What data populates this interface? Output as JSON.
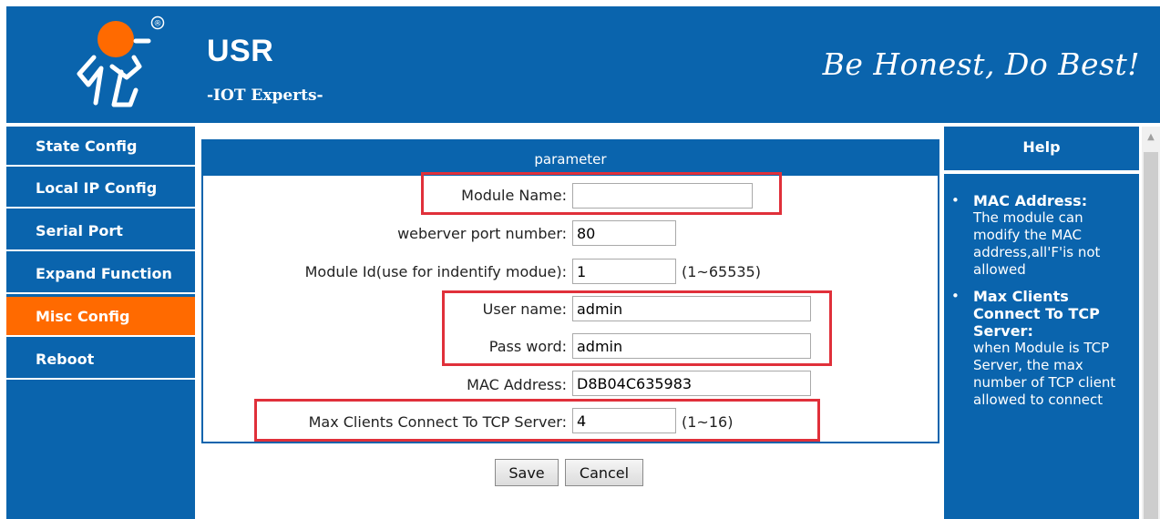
{
  "header": {
    "brand": "USR",
    "tagline": "-IOT Experts-",
    "slogan": "Be Honest, Do Best!",
    "registered_mark": "®"
  },
  "sidebar": {
    "items": [
      {
        "label": "State Config",
        "active": false
      },
      {
        "label": "Local IP Config",
        "active": false
      },
      {
        "label": "Serial Port",
        "active": false
      },
      {
        "label": "Expand Function",
        "active": false
      },
      {
        "label": "Misc Config",
        "active": true
      },
      {
        "label": "Reboot",
        "active": false
      }
    ]
  },
  "main": {
    "panel_title": "parameter",
    "fields": {
      "module_name": {
        "label": "Module Name:",
        "value": ""
      },
      "webserver_port": {
        "label": "weberver port number:",
        "value": "80"
      },
      "module_id": {
        "label": "Module Id(use for indentify modue):",
        "value": "1",
        "hint": "(1~65535)"
      },
      "user_name": {
        "label": "User name:",
        "value": "admin"
      },
      "password": {
        "label": "Pass word:",
        "value": "admin"
      },
      "mac_address": {
        "label": "MAC Address:",
        "value": "D8B04C635983"
      },
      "max_clients": {
        "label": "Max Clients Connect To TCP Server:",
        "value": "4",
        "hint": "(1~16)"
      }
    },
    "buttons": {
      "save": "Save",
      "cancel": "Cancel"
    }
  },
  "help": {
    "title": "Help",
    "bullet": "•",
    "items": [
      {
        "title": "MAC Address:",
        "text": "The module can modify the MAC address,all'F'is not allowed"
      },
      {
        "title": "Max Clients Connect To TCP Server:",
        "text": "when Module is TCP Server, the max number of TCP client allowed to connect"
      }
    ]
  },
  "colors": {
    "primary_blue": "#0a64ad",
    "active_orange": "#ff6a00",
    "highlight_red": "#e0303a"
  },
  "icons": {
    "logo": "usr-runner-logo-icon",
    "scroll_up": "scroll-up-arrow-icon"
  }
}
